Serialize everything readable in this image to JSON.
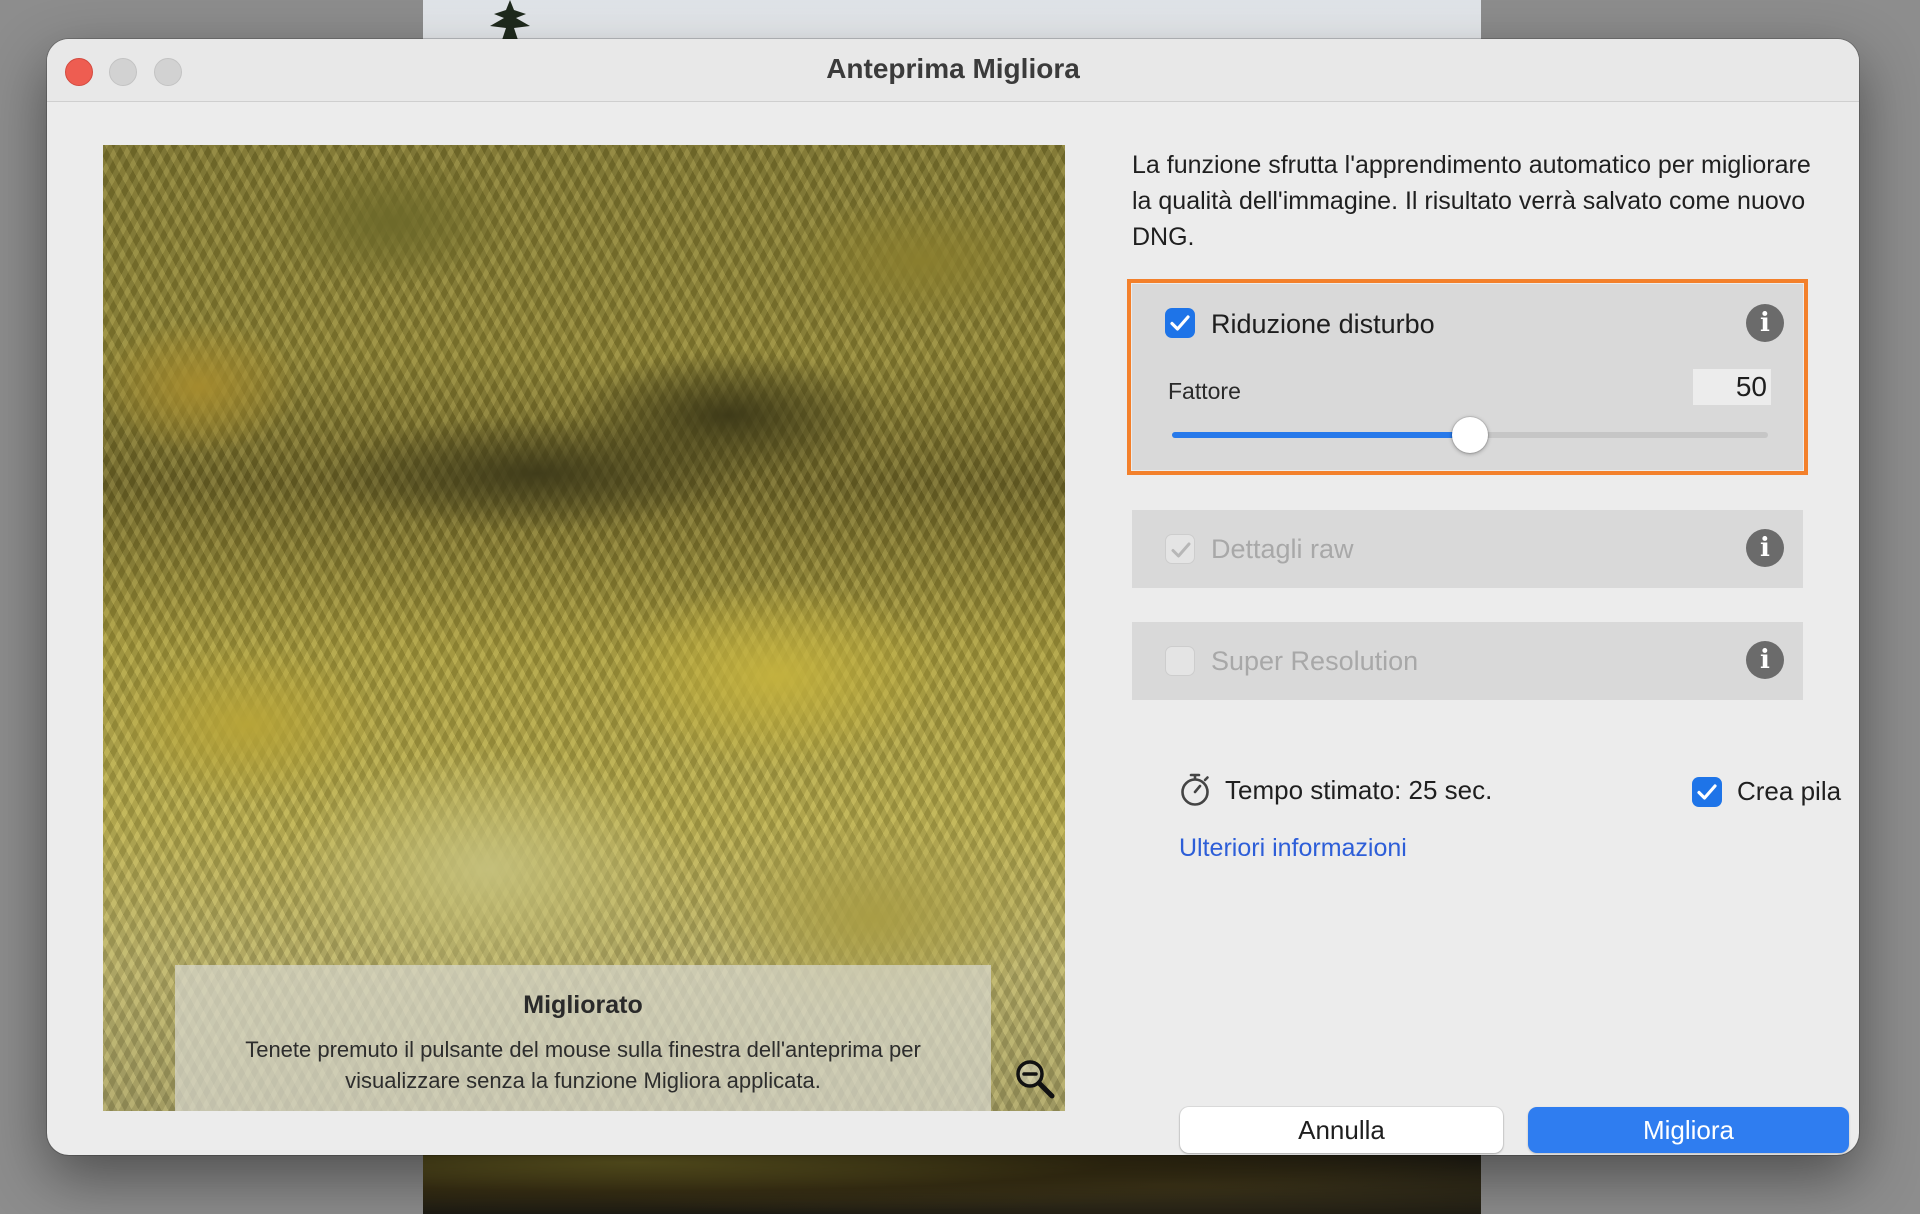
{
  "window": {
    "title": "Anteprima Migliora"
  },
  "preview": {
    "caption_title": "Migliorato",
    "caption_text": "Tenete premuto il pulsante del mouse sulla finestra dell'anteprima per visualizzare senza la funzione Migliora applicata.",
    "zoom_icon": "zoom-out-icon"
  },
  "description": "La funzione sfrutta l'apprendimento automatico per migliorare la qualità dell'immagine. Il risultato verrà salvato come nuovo DNG.",
  "options": {
    "noise_reduction": {
      "label": "Riduzione disturbo",
      "checked": true,
      "factor_label": "Fattore",
      "factor_value": "50",
      "slider_fraction": 0.5
    },
    "raw_details": {
      "label": "Dettagli raw",
      "checked": true,
      "enabled": false
    },
    "super_resolution": {
      "label": "Super Resolution",
      "checked": false,
      "enabled": false
    }
  },
  "estimate": {
    "text": "Tempo stimato: 25 sec."
  },
  "create_stack": {
    "label": "Crea pila",
    "checked": true
  },
  "more_info_link": "Ulteriori informazioni",
  "buttons": {
    "cancel": "Annulla",
    "enhance": "Migliora"
  },
  "colors": {
    "accent": "#2f7df0",
    "highlight_outline": "#f3802b",
    "close_button": "#ee5d51",
    "link": "#2d5ed8"
  }
}
